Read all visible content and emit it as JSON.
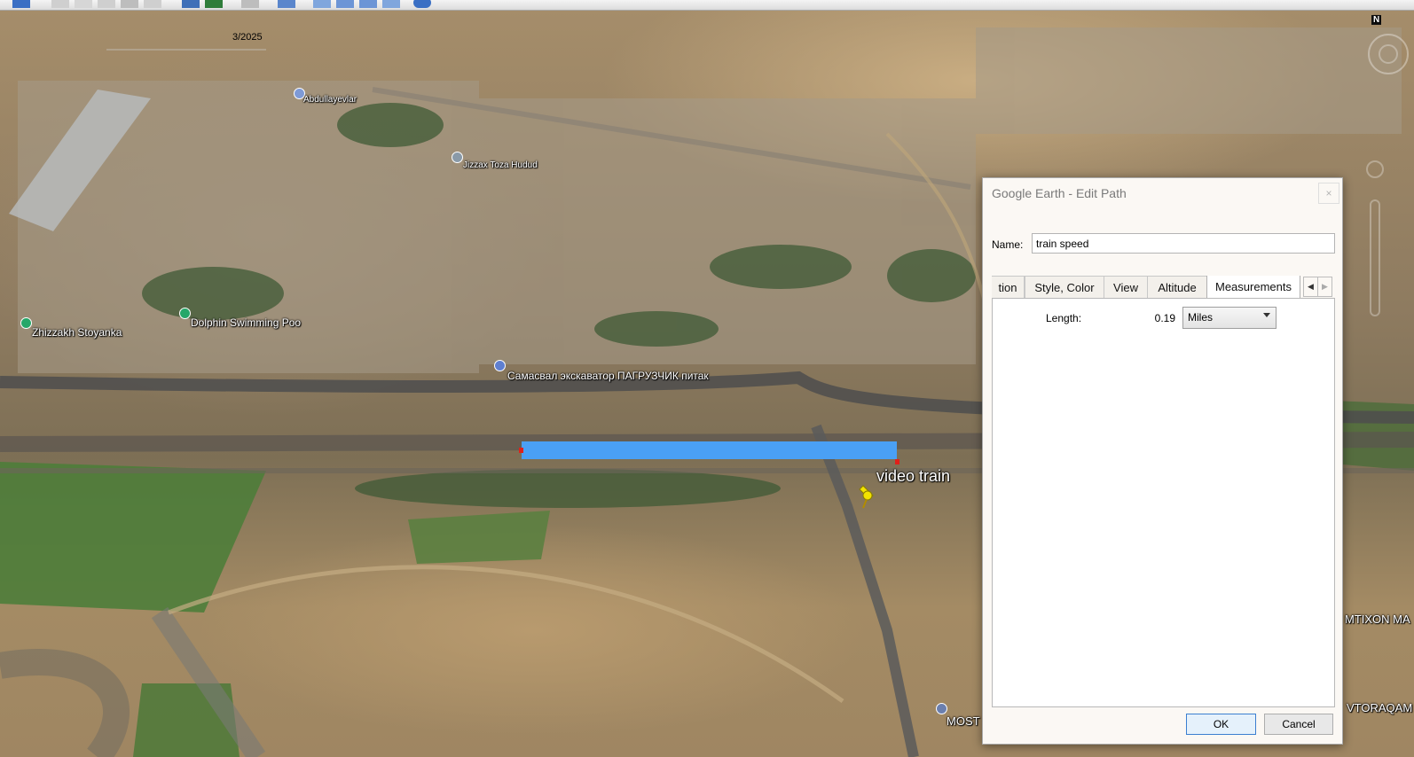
{
  "toolbar": {
    "icons": [
      "placemark-icon",
      "polygon-icon",
      "path-icon",
      "overlay-icon",
      "record-tour-icon",
      "historical-imagery-icon",
      "sun-icon",
      "planets-icon",
      "ruler-icon",
      "email-icon",
      "print-icon",
      "save-image-icon",
      "view-in-maps-icon",
      "globe-icon"
    ]
  },
  "map": {
    "imagery_date": "3/2025",
    "compass": "N",
    "places": {
      "abdullayevlar": "Abdullayevlar",
      "jizzax_toza_hudud": "Jizzax Toza Hudud",
      "zhizzakh_stoyanka": "Zhizzakh Stoyanka",
      "dolphin_pool": "Dolphin Swimming Poo",
      "samosval": "Самасвал экскаватор ПАГРУЗЧИК питак",
      "video_train": "video train",
      "mtixon": "MTIXON MA",
      "vtoraqam": "VTORAQAM",
      "most": "MOST"
    },
    "path_color": "#4aa0f5"
  },
  "dialog": {
    "title": "Google Earth - Edit Path",
    "close": "×",
    "name_label": "Name:",
    "name_value": "train speed",
    "tabs": [
      "tion",
      "Style, Color",
      "View",
      "Altitude",
      "Measurements"
    ],
    "active_tab": "Measurements",
    "measurements": {
      "length_label": "Length:",
      "length_value": "0.19",
      "unit": "Miles"
    },
    "ok": "OK",
    "cancel": "Cancel"
  }
}
